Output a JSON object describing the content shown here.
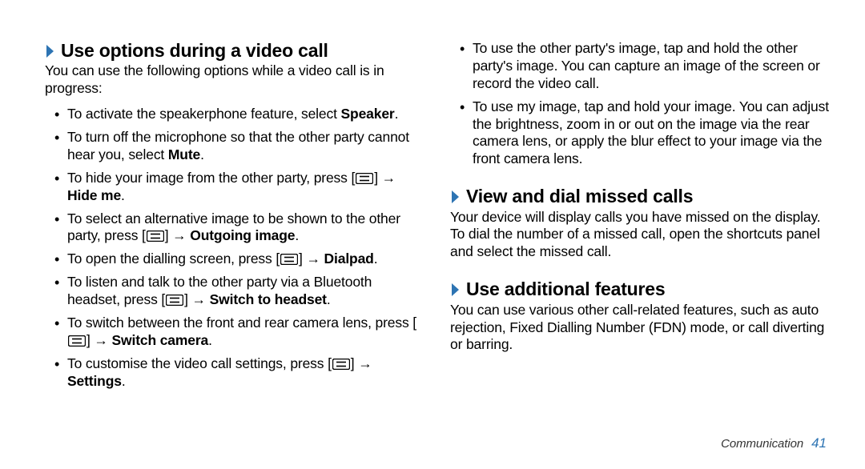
{
  "left": {
    "heading": "Use options during a video call",
    "intro": "You can use the following options while a video call is in progress:",
    "items": [
      {
        "pre": "To activate the speakerphone feature, select ",
        "bold1": "Speaker",
        "post1": "."
      },
      {
        "pre": "To turn off the microphone so that the other party cannot hear you, select ",
        "bold1": "Mute",
        "post1": "."
      },
      {
        "pre": "To hide your image from the other party, press [",
        "icon1": true,
        "mid1": "] → ",
        "bold1": "Hide me",
        "post1": "."
      },
      {
        "pre": "To select an alternative image to be shown to the other party, press [",
        "icon1": true,
        "mid1": "] → ",
        "bold1": "Outgoing image",
        "post1": "."
      },
      {
        "pre": "To open the dialling screen, press [",
        "icon1": true,
        "mid1": "] → ",
        "bold1": "Dialpad",
        "post1": "."
      },
      {
        "pre": "To listen and talk to the other party via a Bluetooth headset, press [",
        "icon1": true,
        "mid1": "] → ",
        "bold1": "Switch to headset",
        "post1": "."
      },
      {
        "pre": "To switch between the front and rear camera lens, press [",
        "icon1": true,
        "mid1": "] → ",
        "bold1": "Switch camera",
        "post1": "."
      },
      {
        "pre": "To customise the video call settings, press [",
        "icon1": true,
        "mid1": "] → ",
        "bold1": "Settings",
        "post1": "."
      }
    ]
  },
  "right": {
    "top_items": [
      {
        "pre": "To use the other party's image, tap and hold the other party's image. You can capture an image of the screen or record the video call."
      },
      {
        "pre": "To use my image, tap and hold your image. You can adjust the brightness, zoom in or out on the image via the rear camera lens, or apply the blur effect to your image via the front camera lens."
      }
    ],
    "sec2_heading": "View and dial missed calls",
    "sec2_body": "Your device will display calls you have missed on the display. To dial the number of a missed call, open the shortcuts panel and select the missed call.",
    "sec3_heading": "Use additional features",
    "sec3_body": "You can use various other call-related features, such as auto rejection, Fixed Dialling Number (FDN) mode, or call diverting or barring."
  },
  "footer": {
    "section": "Communication",
    "page": "41"
  },
  "glyphs": {
    "arrow": " → "
  }
}
